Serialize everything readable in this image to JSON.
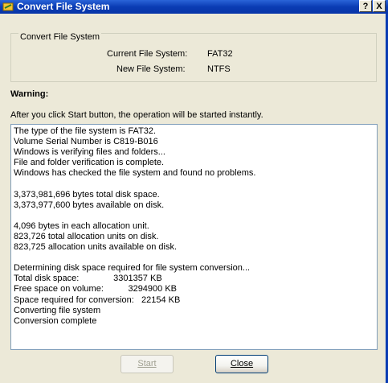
{
  "window": {
    "title": "Convert File System",
    "help_button": "?",
    "close_button": "X"
  },
  "group": {
    "title": "Convert File System",
    "current_label": "Current File System:",
    "current_value": "FAT32",
    "new_label": "New File System:",
    "new_value": "NTFS"
  },
  "warning": {
    "title": "Warning:",
    "text": "After you click Start button, the operation will be started instantly."
  },
  "log": {
    "lines": [
      "The type of the file system is FAT32.",
      "Volume Serial Number is C819-B016",
      "Windows is verifying files and folders...",
      "File and folder verification is complete.",
      "Windows has checked the file system and found no problems.",
      "",
      "3,373,981,696 bytes total disk space.",
      "3,373,977,600 bytes available on disk.",
      "",
      "4,096 bytes in each allocation unit.",
      "823,726 total allocation units on disk.",
      "823,725 allocation units available on disk.",
      "",
      "Determining disk space required for file system conversion...",
      "Total disk space:              3301357 KB",
      "Free space on volume:          3294900 KB",
      "Space required for conversion:   22154 KB",
      "Converting file system",
      "Conversion complete"
    ]
  },
  "buttons": {
    "start": "Start",
    "close": "Close"
  }
}
